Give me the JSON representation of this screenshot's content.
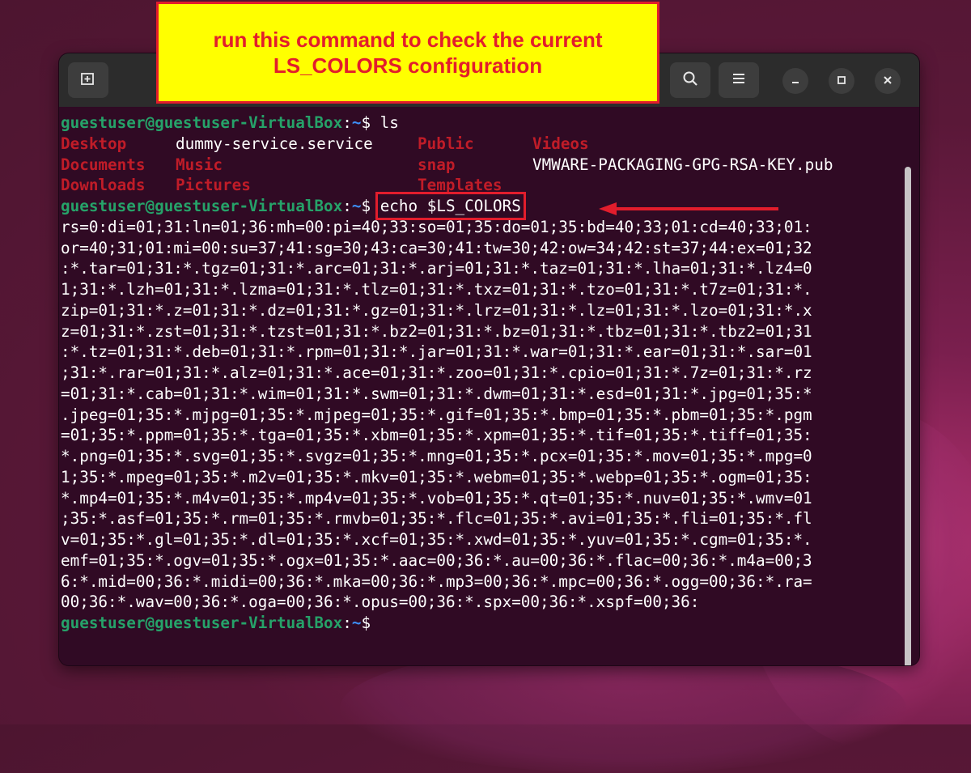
{
  "callout": {
    "line1": "run this command to check the current",
    "line2": "LS_COLORS configuration"
  },
  "icons": {
    "new_tab": "new-tab-icon",
    "search": "search-icon",
    "menu": "hamburger-menu-icon",
    "minimize": "minimize-icon",
    "maximize": "maximize-icon",
    "close": "close-icon"
  },
  "colors": {
    "prompt_user": "#26a269",
    "prompt_path": "#3d8ef5",
    "directory": "#c01c28",
    "background": "#300a24",
    "annotation": "#e21d2c",
    "callout_bg": "#ffff00"
  },
  "terminal": {
    "prompt": {
      "user": "guestuser@guestuser-VirtualBox",
      "colon": ":",
      "path": "~",
      "dollar": "$"
    },
    "command1": " ls",
    "ls_rows": [
      [
        {
          "name": "Desktop",
          "type": "dir"
        },
        {
          "name": "dummy-service.service",
          "type": "file"
        },
        {
          "name": "Public",
          "type": "dir"
        },
        {
          "name": "Videos",
          "type": "dir"
        }
      ],
      [
        {
          "name": "Documents",
          "type": "dir"
        },
        {
          "name": "Music",
          "type": "dir"
        },
        {
          "name": "snap",
          "type": "dir"
        },
        {
          "name": "VMWARE-PACKAGING-GPG-RSA-KEY.pub",
          "type": "file"
        }
      ],
      [
        {
          "name": "Downloads",
          "type": "dir"
        },
        {
          "name": "Pictures",
          "type": "dir"
        },
        {
          "name": "Templates",
          "type": "dir"
        },
        {
          "name": "",
          "type": "file"
        }
      ]
    ],
    "command2": "echo $LS_COLORS",
    "output_lines": [
      "rs=0:di=01;31:ln=01;36:mh=00:pi=40;33:so=01;35:do=01;35:bd=40;33;01:cd=40;33;01:",
      "or=40;31;01:mi=00:su=37;41:sg=30;43:ca=30;41:tw=30;42:ow=34;42:st=37;44:ex=01;32",
      ":*.tar=01;31:*.tgz=01;31:*.arc=01;31:*.arj=01;31:*.taz=01;31:*.lha=01;31:*.lz4=0",
      "1;31:*.lzh=01;31:*.lzma=01;31:*.tlz=01;31:*.txz=01;31:*.tzo=01;31:*.t7z=01;31:*.",
      "zip=01;31:*.z=01;31:*.dz=01;31:*.gz=01;31:*.lrz=01;31:*.lz=01;31:*.lzo=01;31:*.x",
      "z=01;31:*.zst=01;31:*.tzst=01;31:*.bz2=01;31:*.bz=01;31:*.tbz=01;31:*.tbz2=01;31",
      ":*.tz=01;31:*.deb=01;31:*.rpm=01;31:*.jar=01;31:*.war=01;31:*.ear=01;31:*.sar=01",
      ";31:*.rar=01;31:*.alz=01;31:*.ace=01;31:*.zoo=01;31:*.cpio=01;31:*.7z=01;31:*.rz",
      "=01;31:*.cab=01;31:*.wim=01;31:*.swm=01;31:*.dwm=01;31:*.esd=01;31:*.jpg=01;35:*",
      ".jpeg=01;35:*.mjpg=01;35:*.mjpeg=01;35:*.gif=01;35:*.bmp=01;35:*.pbm=01;35:*.pgm",
      "=01;35:*.ppm=01;35:*.tga=01;35:*.xbm=01;35:*.xpm=01;35:*.tif=01;35:*.tiff=01;35:",
      "*.png=01;35:*.svg=01;35:*.svgz=01;35:*.mng=01;35:*.pcx=01;35:*.mov=01;35:*.mpg=0",
      "1;35:*.mpeg=01;35:*.m2v=01;35:*.mkv=01;35:*.webm=01;35:*.webp=01;35:*.ogm=01;35:",
      "*.mp4=01;35:*.m4v=01;35:*.mp4v=01;35:*.vob=01;35:*.qt=01;35:*.nuv=01;35:*.wmv=01",
      ";35:*.asf=01;35:*.rm=01;35:*.rmvb=01;35:*.flc=01;35:*.avi=01;35:*.fli=01;35:*.fl",
      "v=01;35:*.gl=01;35:*.dl=01;35:*.xcf=01;35:*.xwd=01;35:*.yuv=01;35:*.cgm=01;35:*.",
      "emf=01;35:*.ogv=01;35:*.ogx=01;35:*.aac=00;36:*.au=00;36:*.flac=00;36:*.m4a=00;3",
      "6:*.mid=00;36:*.midi=00;36:*.mka=00;36:*.mp3=00;36:*.mpc=00;36:*.ogg=00;36:*.ra=",
      "00;36:*.wav=00;36:*.oga=00;36:*.opus=00;36:*.spx=00;36:*.xspf=00;36:"
    ]
  }
}
